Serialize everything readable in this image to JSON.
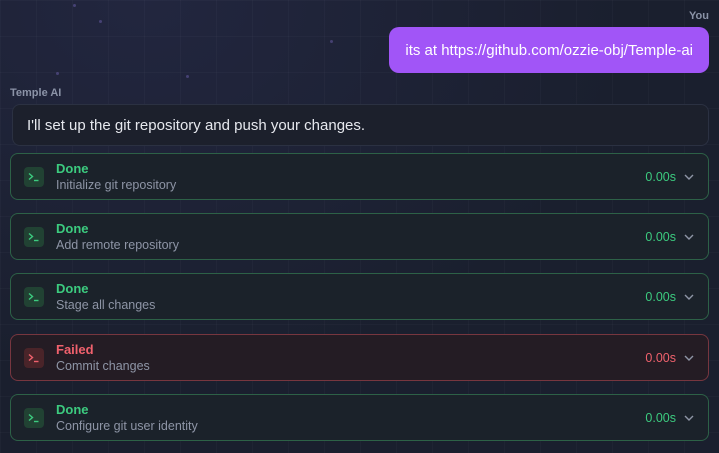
{
  "conversation": {
    "user": {
      "speaker": "You",
      "message": "its at https://github.com/ozzie-obj/Temple-ai"
    },
    "assistant": {
      "speaker": "Temple AI",
      "message": "I'll set up the git repository and push your changes."
    }
  },
  "steps": [
    {
      "status": "Done",
      "label": "Initialize git repository",
      "time": "0.00s",
      "state": "done",
      "icon": "terminal-icon"
    },
    {
      "status": "Done",
      "label": "Add remote repository",
      "time": "0.00s",
      "state": "done",
      "icon": "terminal-icon"
    },
    {
      "status": "Done",
      "label": "Stage all changes",
      "time": "0.00s",
      "state": "done",
      "icon": "terminal-icon"
    },
    {
      "status": "Failed",
      "label": "Commit changes",
      "time": "0.00s",
      "state": "failed",
      "icon": "terminal-icon"
    },
    {
      "status": "Done",
      "label": "Configure git user identity",
      "time": "0.00s",
      "state": "done",
      "icon": "terminal-icon"
    }
  ],
  "colors": {
    "user_bubble": "#a155f7",
    "done": "#3ccb7f",
    "failed": "#f0616d",
    "background": "#1a1f2e"
  }
}
